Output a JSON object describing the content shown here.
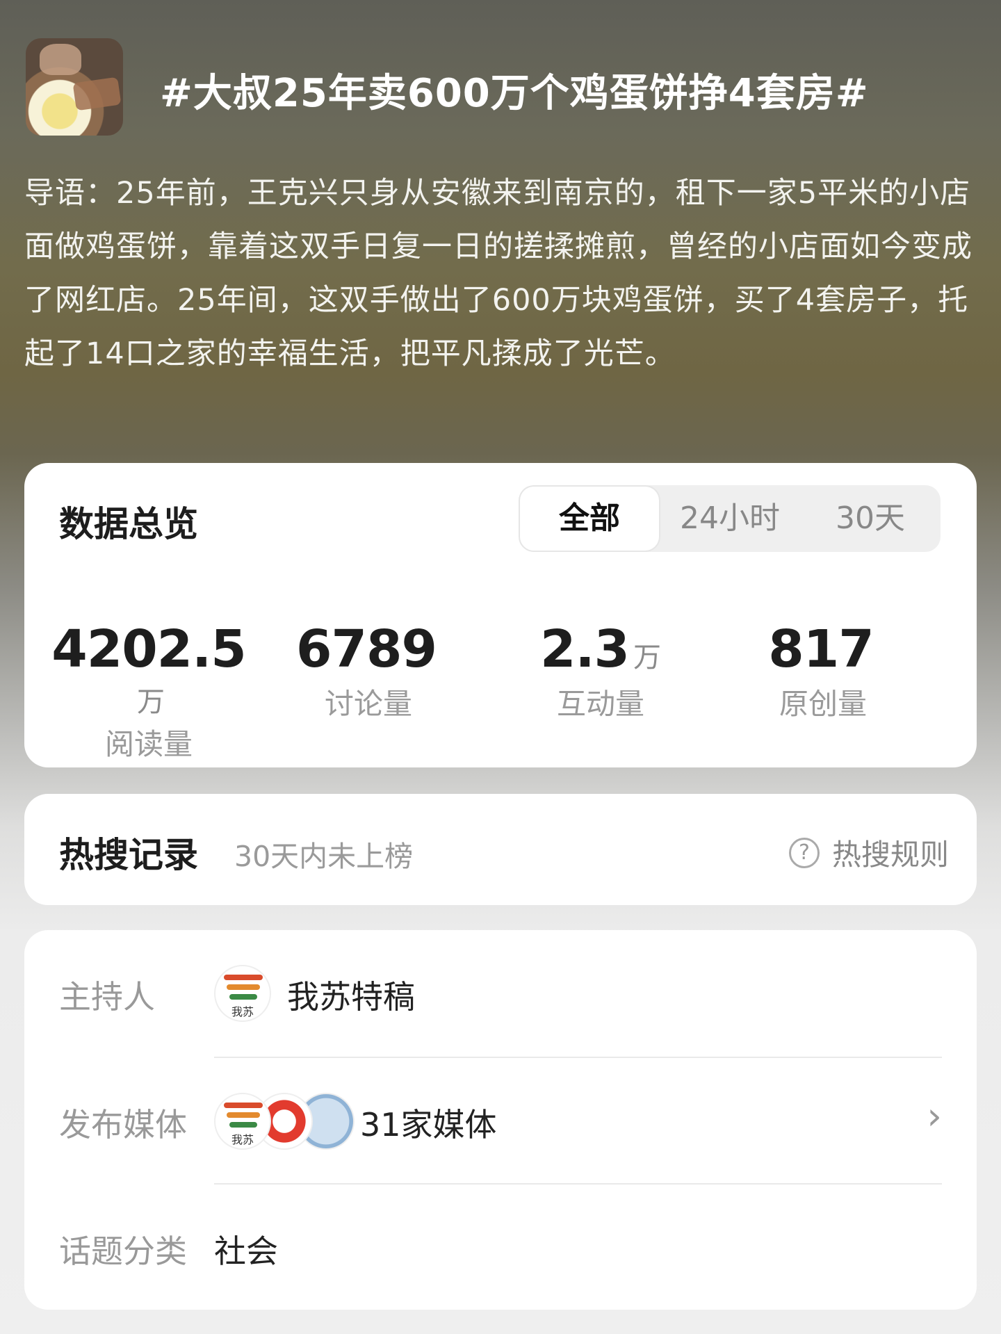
{
  "topic": {
    "title": "#大叔25年卖600万个鸡蛋饼挣4套房#",
    "thumbnail_icon": "egg-pancake-photo",
    "intro": "导语：25年前，王克兴只身从安徽来到南京的，租下一家5平米的小店面做鸡蛋饼，靠着这双手日复一日的搓揉摊煎，曾经的小店面如今变成了网红店。25年间，这双手做出了600万块鸡蛋饼，买了4套房子，托起了14口之家的幸福生活，把平凡揉成了光芒。"
  },
  "overview": {
    "title": "数据总览",
    "tabs": [
      "全部",
      "24小时",
      "30天"
    ],
    "active_tab": "全部",
    "stats": [
      {
        "value": "4202.5",
        "unit": "万",
        "label": "阅读量"
      },
      {
        "value": "6789",
        "unit": "",
        "label": "讨论量"
      },
      {
        "value": "2.3",
        "unit": "万",
        "label": "互动量"
      },
      {
        "value": "817",
        "unit": "",
        "label": "原创量"
      }
    ]
  },
  "hot_search": {
    "title": "热搜记录",
    "status": "30天内未上榜",
    "rules_label": "热搜规则",
    "rules_icon": "question-circle-icon"
  },
  "info": {
    "host_label": "主持人",
    "host_name": "我苏特稿",
    "host_avatar_text": "我苏",
    "media_label": "发布媒体",
    "media_value": "31家媒体",
    "media_avatar_text": "我苏",
    "category_label": "话题分类",
    "category_value": "社会"
  }
}
